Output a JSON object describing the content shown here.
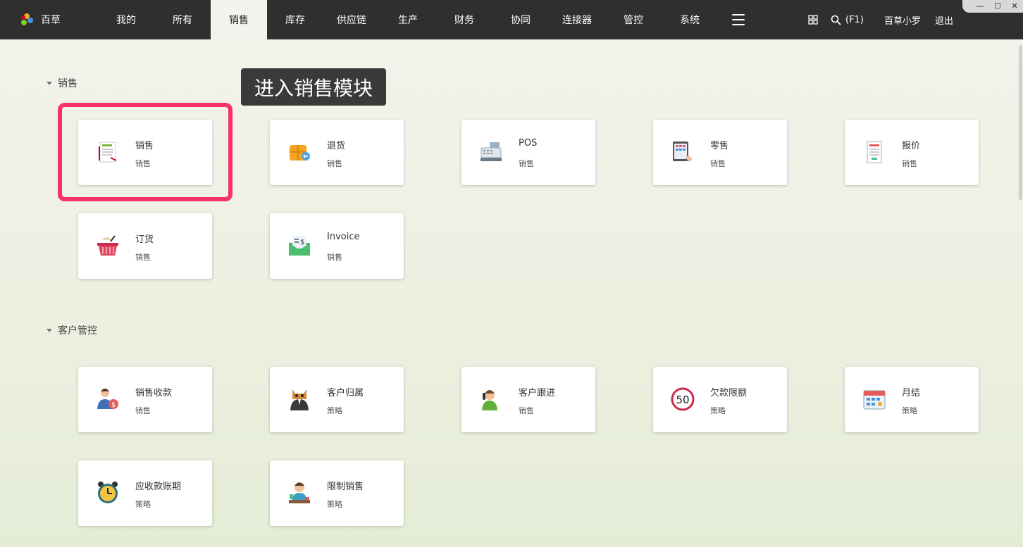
{
  "app": {
    "logo_text": "百草"
  },
  "nav": {
    "items": [
      {
        "label": "我的"
      },
      {
        "label": "所有"
      },
      {
        "label": "销售"
      },
      {
        "label": "库存"
      },
      {
        "label": "供应链"
      },
      {
        "label": "生产"
      },
      {
        "label": "财务"
      },
      {
        "label": "协同"
      },
      {
        "label": "连接器"
      },
      {
        "label": "管控"
      },
      {
        "label": "系统"
      }
    ],
    "active_index": 2
  },
  "toolbar": {
    "search_hint": "(F1)",
    "user_name": "百草小罗",
    "logout_label": "退出"
  },
  "window": {
    "minimize": "—",
    "maximize": "☐",
    "close": "✕"
  },
  "tooltip": {
    "text": "进入销售模块"
  },
  "sections": [
    {
      "title": "销售",
      "tiles": [
        {
          "name": "销售",
          "sub": "销售",
          "icon": "sales-order-icon"
        },
        {
          "name": "退货",
          "sub": "销售",
          "icon": "return-box-icon"
        },
        {
          "name": "POS",
          "sub": "销售",
          "icon": "cash-register-icon"
        },
        {
          "name": "零售",
          "sub": "销售",
          "icon": "retail-tablet-icon"
        },
        {
          "name": "报价",
          "sub": "销售",
          "icon": "quotation-icon"
        },
        {
          "name": "订货",
          "sub": "销售",
          "icon": "shopping-basket-icon"
        },
        {
          "name": "Invoice",
          "sub": "销售",
          "icon": "invoice-envelope-icon"
        }
      ]
    },
    {
      "title": "客户管控",
      "tiles": [
        {
          "name": "销售收款",
          "sub": "销售",
          "icon": "payment-person-icon"
        },
        {
          "name": "客户归属",
          "sub": "策略",
          "icon": "owner-cat-icon"
        },
        {
          "name": "客户跟进",
          "sub": "销售",
          "icon": "phone-call-icon"
        },
        {
          "name": "欠款限额",
          "sub": "策略",
          "icon": "limit-50-icon"
        },
        {
          "name": "月结",
          "sub": "策略",
          "icon": "calendar-icon"
        },
        {
          "name": "应收款账期",
          "sub": "策略",
          "icon": "alarm-clock-icon"
        },
        {
          "name": "限制销售",
          "sub": "策略",
          "icon": "restricted-sales-icon"
        }
      ]
    }
  ],
  "limit_icon_number": "50",
  "colors": {
    "highlight": "#f7326b",
    "topbar": "#2f2f2f",
    "tooltip": "#3a3a3a"
  }
}
